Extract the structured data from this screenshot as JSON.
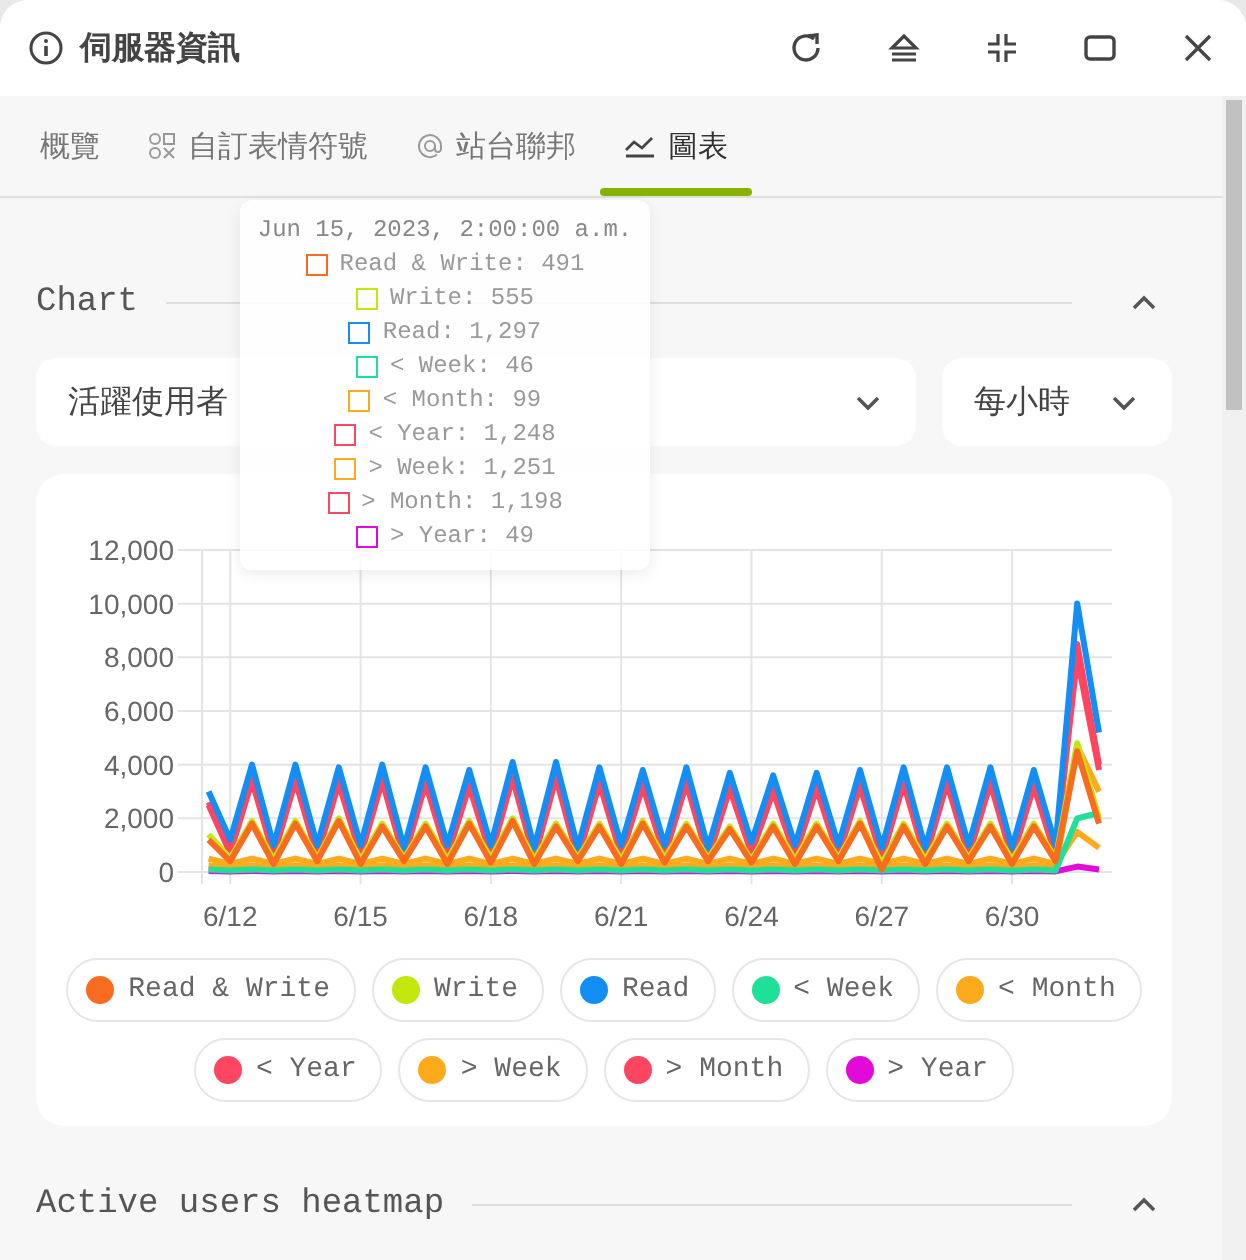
{
  "window": {
    "title": "伺服器資訊"
  },
  "tabs": [
    {
      "label": "概覽",
      "selected": false
    },
    {
      "label": "自訂表情符號",
      "selected": false
    },
    {
      "label": "站台聯邦",
      "selected": false
    },
    {
      "label": "圖表",
      "selected": true
    }
  ],
  "sections": [
    {
      "title": "Chart",
      "expanded": true
    },
    {
      "title": "Active users heatmap",
      "expanded": true
    }
  ],
  "filters": [
    {
      "value": "活躍使用者"
    },
    {
      "value": "每小時"
    }
  ],
  "chart_data": {
    "type": "line",
    "grid": true,
    "ylim": [
      0,
      12000
    ],
    "yticks": [
      {
        "value": 0,
        "label": "0"
      },
      {
        "value": 2000,
        "label": "2,000"
      },
      {
        "value": 4000,
        "label": "4,000"
      },
      {
        "value": 6000,
        "label": "6,000"
      },
      {
        "value": 8000,
        "label": "8,000"
      },
      {
        "value": 10000,
        "label": "10,000"
      },
      {
        "value": 12000,
        "label": "12,000"
      }
    ],
    "categories": [
      null,
      "6/12",
      null,
      null,
      null,
      null,
      null,
      "6/15",
      null,
      null,
      null,
      null,
      null,
      "6/18",
      null,
      null,
      null,
      null,
      null,
      "6/21",
      null,
      null,
      null,
      null,
      null,
      "6/24",
      null,
      null,
      null,
      null,
      null,
      "6/27",
      null,
      null,
      null,
      null,
      null,
      "6/30",
      null,
      null,
      null,
      null
    ],
    "series": [
      {
        "name": "Read & Write",
        "color": "#f96b1f",
        "values": [
          1200,
          400,
          1800,
          300,
          1800,
          400,
          1900,
          300,
          1700,
          400,
          1700,
          300,
          1800,
          350,
          1900,
          300,
          1700,
          400,
          1700,
          300,
          1800,
          350,
          1700,
          400,
          1600,
          350,
          1700,
          300,
          1700,
          400,
          1800,
          100,
          1700,
          300,
          1700,
          400,
          1700,
          300,
          1700,
          400,
          4500,
          1800
        ]
      },
      {
        "name": "Write",
        "color": "#c3e60c",
        "values": [
          1400,
          500,
          1900,
          450,
          1900,
          500,
          2000,
          450,
          1800,
          500,
          1800,
          450,
          1900,
          500,
          2000,
          450,
          1800,
          500,
          1800,
          450,
          1900,
          500,
          1800,
          500,
          1700,
          450,
          1800,
          450,
          1800,
          500,
          1900,
          300,
          1800,
          450,
          1800,
          500,
          1800,
          450,
          1800,
          500,
          4800,
          2000
        ]
      },
      {
        "name": "Read",
        "color": "#128ef5",
        "values": [
          3000,
          1200,
          4000,
          1000,
          4000,
          1000,
          3900,
          1000,
          4000,
          900,
          3900,
          1000,
          3800,
          1000,
          4100,
          900,
          4100,
          900,
          3900,
          1000,
          3800,
          1000,
          3900,
          900,
          3700,
          1100,
          3600,
          1000,
          3700,
          1000,
          3800,
          900,
          3900,
          900,
          3900,
          1000,
          3900,
          900,
          3800,
          1000,
          10000,
          5200
        ]
      },
      {
        "name": "< Week",
        "color": "#1fe099",
        "values": [
          100,
          50,
          100,
          50,
          100,
          50,
          100,
          50,
          100,
          50,
          100,
          50,
          100,
          50,
          100,
          50,
          100,
          50,
          100,
          50,
          100,
          50,
          100,
          50,
          100,
          50,
          100,
          50,
          100,
          50,
          100,
          50,
          100,
          50,
          100,
          50,
          100,
          50,
          100,
          50,
          2000,
          2200
        ]
      },
      {
        "name": "< Month",
        "color": "#fdab1c",
        "values": [
          250,
          150,
          250,
          150,
          250,
          150,
          250,
          150,
          250,
          150,
          250,
          150,
          250,
          150,
          250,
          150,
          250,
          150,
          250,
          150,
          250,
          150,
          250,
          150,
          250,
          150,
          250,
          150,
          250,
          150,
          250,
          150,
          250,
          150,
          250,
          150,
          250,
          150,
          250,
          150,
          4700,
          3000
        ]
      },
      {
        "name": "< Year",
        "color": "#fe4562",
        "values": [
          2500,
          700,
          3400,
          600,
          3400,
          600,
          3300,
          600,
          3400,
          500,
          3300,
          600,
          3200,
          600,
          3500,
          500,
          3500,
          500,
          3300,
          600,
          3200,
          600,
          3300,
          500,
          3100,
          700,
          3000,
          600,
          3100,
          600,
          3200,
          500,
          3300,
          500,
          3300,
          600,
          3300,
          500,
          3200,
          600,
          8500,
          4000
        ]
      },
      {
        "name": "> Week",
        "color": "#fdab1c",
        "values": [
          500,
          300,
          500,
          300,
          500,
          300,
          500,
          300,
          500,
          300,
          500,
          300,
          500,
          300,
          500,
          300,
          500,
          300,
          500,
          300,
          500,
          300,
          500,
          300,
          500,
          300,
          500,
          300,
          500,
          300,
          500,
          300,
          500,
          300,
          500,
          300,
          500,
          300,
          500,
          300,
          1500,
          900
        ]
      },
      {
        "name": "> Month",
        "color": "#fe4562",
        "values": [
          2600,
          1000,
          3500,
          800,
          3500,
          800,
          3400,
          800,
          3500,
          700,
          3400,
          800,
          3300,
          800,
          3600,
          700,
          3600,
          700,
          3400,
          800,
          3300,
          800,
          3400,
          700,
          3200,
          900,
          3100,
          800,
          3200,
          800,
          3300,
          700,
          3400,
          700,
          3400,
          800,
          3400,
          700,
          3300,
          800,
          8000,
          3800
        ]
      },
      {
        "name": "> Year",
        "color": "#e10ad8",
        "values": [
          40,
          20,
          40,
          20,
          40,
          20,
          40,
          20,
          40,
          20,
          40,
          20,
          40,
          20,
          40,
          20,
          40,
          20,
          40,
          20,
          40,
          20,
          40,
          20,
          40,
          20,
          40,
          20,
          40,
          20,
          40,
          20,
          40,
          20,
          40,
          20,
          40,
          20,
          40,
          20,
          200,
          100
        ]
      }
    ]
  },
  "tooltip": {
    "title": "Jun 15, 2023, 2:00:00 a.m.",
    "items": [
      {
        "label": "Read & Write: 491",
        "color": "#f96b1f"
      },
      {
        "label": "Write: 555",
        "color": "#c3e60c"
      },
      {
        "label": "Read: 1,297",
        "color": "#128ef5"
      },
      {
        "label": "< Week: 46",
        "color": "#1fe099"
      },
      {
        "label": "< Month: 99",
        "color": "#fdab1c"
      },
      {
        "label": "< Year: 1,248",
        "color": "#fe4562"
      },
      {
        "label": "> Week: 1,251",
        "color": "#fdab1c"
      },
      {
        "label": "> Month: 1,198",
        "color": "#fe4562"
      },
      {
        "label": "> Year: 49",
        "color": "#e10ad8"
      }
    ]
  }
}
